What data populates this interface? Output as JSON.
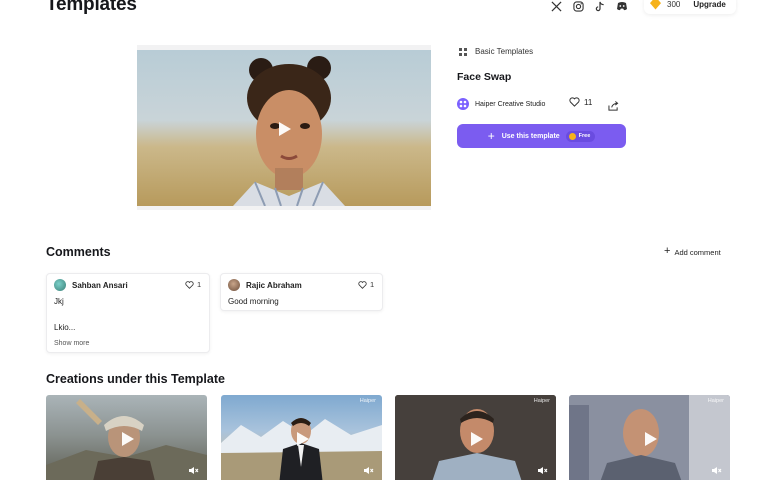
{
  "header": {
    "title": "Templates",
    "credits": "300",
    "upgrade_label": "Upgrade",
    "social_icons": [
      "x-icon",
      "instagram-icon",
      "tiktok-icon",
      "discord-icon"
    ]
  },
  "template": {
    "category": "Basic Templates",
    "name": "Face Swap",
    "creator": "Haiper Creative Studio",
    "likes": "11",
    "use_button_label": "Use this template",
    "free_label": "Free"
  },
  "comments": {
    "heading": "Comments",
    "add_label": "Add comment",
    "items": [
      {
        "author": "Sahban Ansari",
        "likes": "1",
        "lines": [
          "Jkj",
          "Lkio..."
        ],
        "show_more": "Show more"
      },
      {
        "author": "Rajic Abraham",
        "likes": "1",
        "lines": [
          "Good morning"
        ]
      }
    ]
  },
  "creations": {
    "heading": "Creations under this Template",
    "watermark": "Haiper"
  },
  "colors": {
    "accent": "#7b5cf0",
    "gem": "#f6b21b"
  }
}
